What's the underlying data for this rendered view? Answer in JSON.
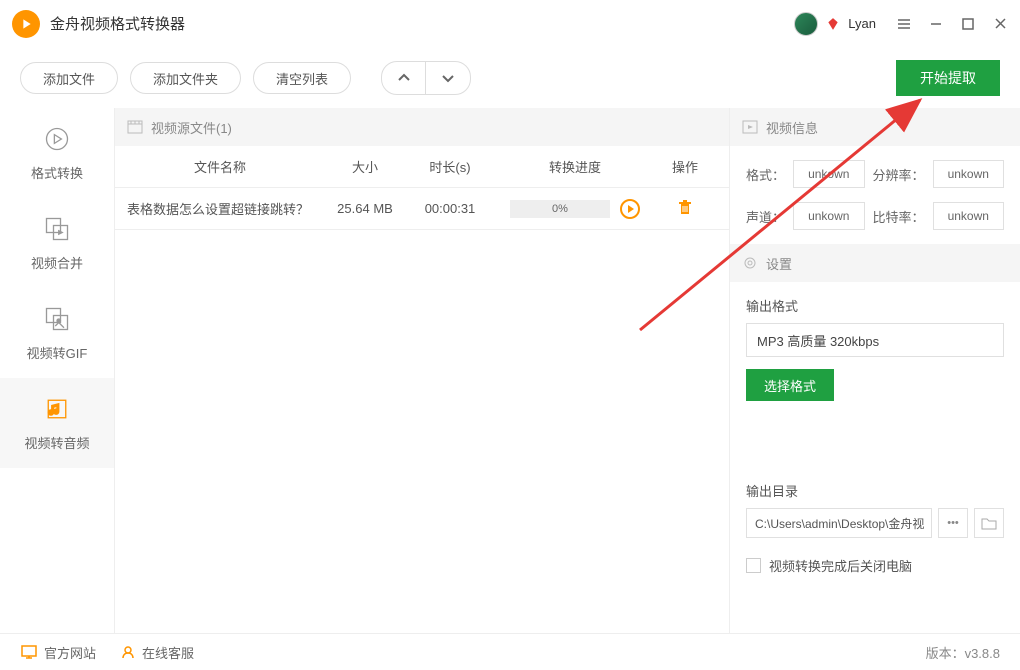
{
  "titlebar": {
    "app_title": "金舟视频格式转换器",
    "username": "Lyan"
  },
  "toolbar": {
    "add_file": "添加文件",
    "add_folder": "添加文件夹",
    "clear_list": "清空列表",
    "start_extract": "开始提取"
  },
  "sidebar": {
    "items": [
      {
        "label": "格式转换"
      },
      {
        "label": "视频合并"
      },
      {
        "label": "视频转GIF"
      },
      {
        "label": "视频转音频"
      }
    ]
  },
  "file_pane": {
    "header": "视频源文件(1)",
    "columns": {
      "name": "文件名称",
      "size": "大小",
      "duration": "时长(s)",
      "progress": "转换进度",
      "action": "操作"
    },
    "rows": [
      {
        "name": "表格数据怎么设置超链接跳转？",
        "size": "25.64 MB",
        "duration": "00:00:31",
        "progress": "0%"
      }
    ]
  },
  "info_pane": {
    "header": "视频信息",
    "labels": {
      "format": "格式：",
      "resolution": "分辨率：",
      "channels": "声道：",
      "bitrate": "比特率："
    },
    "values": {
      "format": "unkown",
      "resolution": "unkown",
      "channels": "unkown",
      "bitrate": "unkown"
    }
  },
  "settings": {
    "header": "设置",
    "output_format_label": "输出格式",
    "output_format_value": "MP3 高质量 320kbps",
    "choose_format": "选择格式",
    "output_dir_label": "输出目录",
    "output_dir_value": "C:\\Users\\admin\\Desktop\\金舟视",
    "shutdown_after": "视频转换完成后关闭电脑"
  },
  "footer": {
    "official_site": "官方网站",
    "online_service": "在线客服",
    "version_label": "版本：",
    "version": "v3.8.8"
  }
}
